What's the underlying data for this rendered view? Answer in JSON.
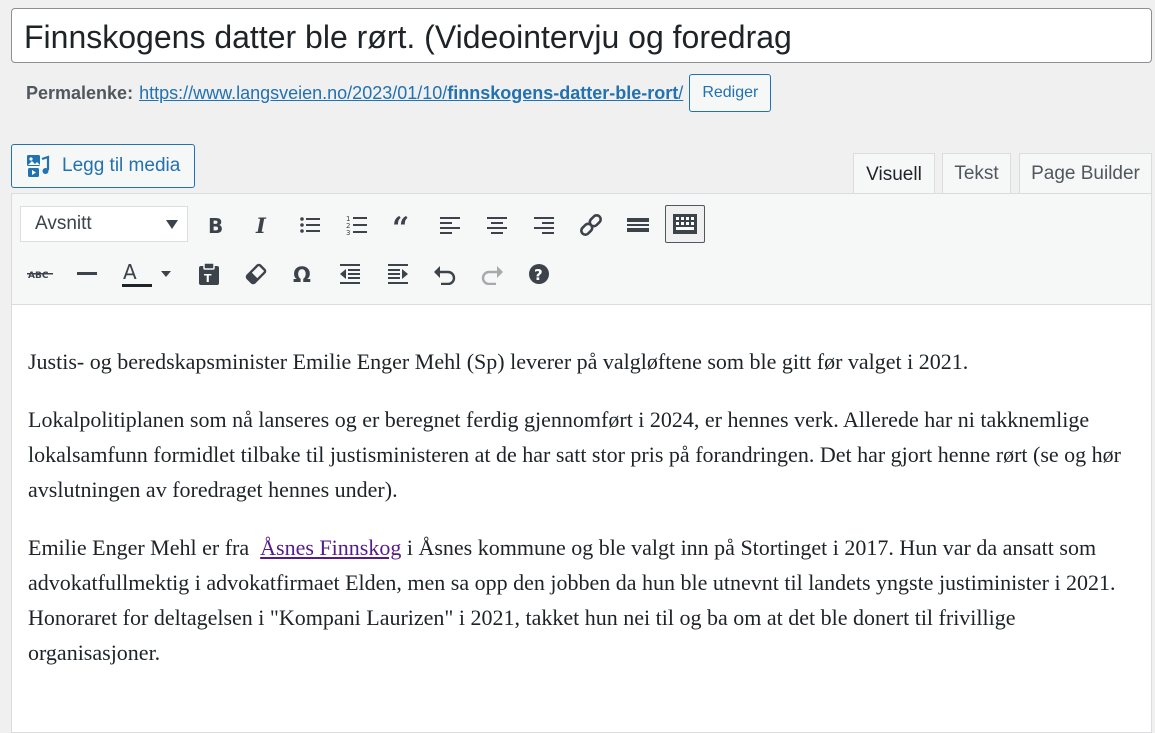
{
  "title": {
    "value": "Finnskogens datter ble rørt. (Videointervju og foredrag"
  },
  "permalink": {
    "label": "Permalenke:",
    "base": "https://www.langsveien.no/2023/01/10/",
    "slug": "finnskogens-datter-ble-rort",
    "trailing": "/",
    "edit_button": "Rediger"
  },
  "media_button": {
    "label": "Legg til media",
    "icon": "media-icon"
  },
  "tabs": [
    {
      "label": "Visuell",
      "active": true
    },
    {
      "label": "Tekst",
      "active": false
    },
    {
      "label": "Page Builder",
      "active": false
    }
  ],
  "toolbar": {
    "format_select": "Avsnitt",
    "row1_icons": [
      "bold-icon",
      "italic-icon",
      "bullet-list-icon",
      "numbered-list-icon",
      "blockquote-icon",
      "align-left-icon",
      "align-center-icon",
      "align-right-icon",
      "link-icon",
      "read-more-icon",
      "toolbar-toggle-icon"
    ],
    "row2_icons": [
      "strikethrough-icon",
      "horizontal-line-icon",
      "text-color-icon",
      "paste-text-icon",
      "clear-formatting-icon",
      "special-character-icon",
      "outdent-icon",
      "indent-icon",
      "undo-icon",
      "redo-icon",
      "help-icon"
    ],
    "text_color": "#1d2327"
  },
  "content": {
    "p1": "Justis- og beredskapsminister Emilie Enger Mehl (Sp)  leverer på valgløftene som ble gitt før valget i 2021.",
    "p2": "Lokalpolitiplanen som nå lanseres og er beregnet ferdig gjennomført i 2024, er hennes verk. Allerede har ni takknemlige lokalsamfunn formidlet tilbake til justisministeren at de har satt stor pris på forandringen. Det har gjort henne rørt (se og hør avslutningen av foredraget hennes under).",
    "p3_before": "Emilie Enger Mehl er fra  ",
    "p3_link": "Åsnes Finnskog",
    "p3_after": " i Åsnes kommune og ble valgt inn på Stortinget i 2017. Hun var da ansatt som advokatfullmektig i advokatfirmaet Elden, men sa opp den jobben da hun ble utnevnt til landets yngste justiminister i 2021. Honoraret for deltagelsen i \"Kompani Laurizen\" i 2021, takket hun nei til og ba om at det ble donert til frivillige organisasjoner."
  },
  "colors": {
    "accent": "#2271b1",
    "link_visited": "#551a8b",
    "background": "#f0f0f1"
  }
}
